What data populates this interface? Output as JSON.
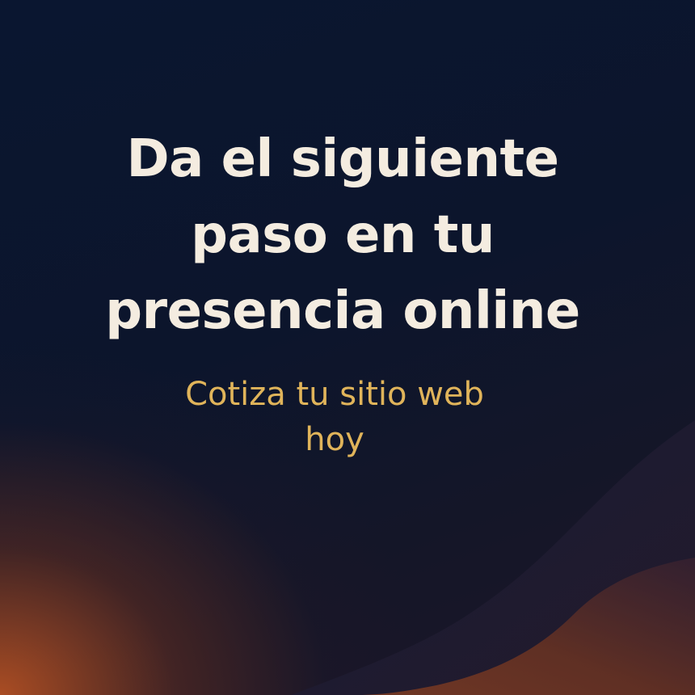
{
  "headline": {
    "line1": "Da el siguiente",
    "line2": "paso en tu",
    "line3": "presencia online"
  },
  "subline": {
    "line1": "Cotiza tu sitio web",
    "line2": "hoy"
  },
  "colors": {
    "background": "#0b1428",
    "headline_text": "#f4ece0",
    "subline_text": "#e0b45a",
    "accent_glow": "#c45622",
    "wave_dark": "#1a1a2e",
    "wave_copper": "#6e3420"
  }
}
